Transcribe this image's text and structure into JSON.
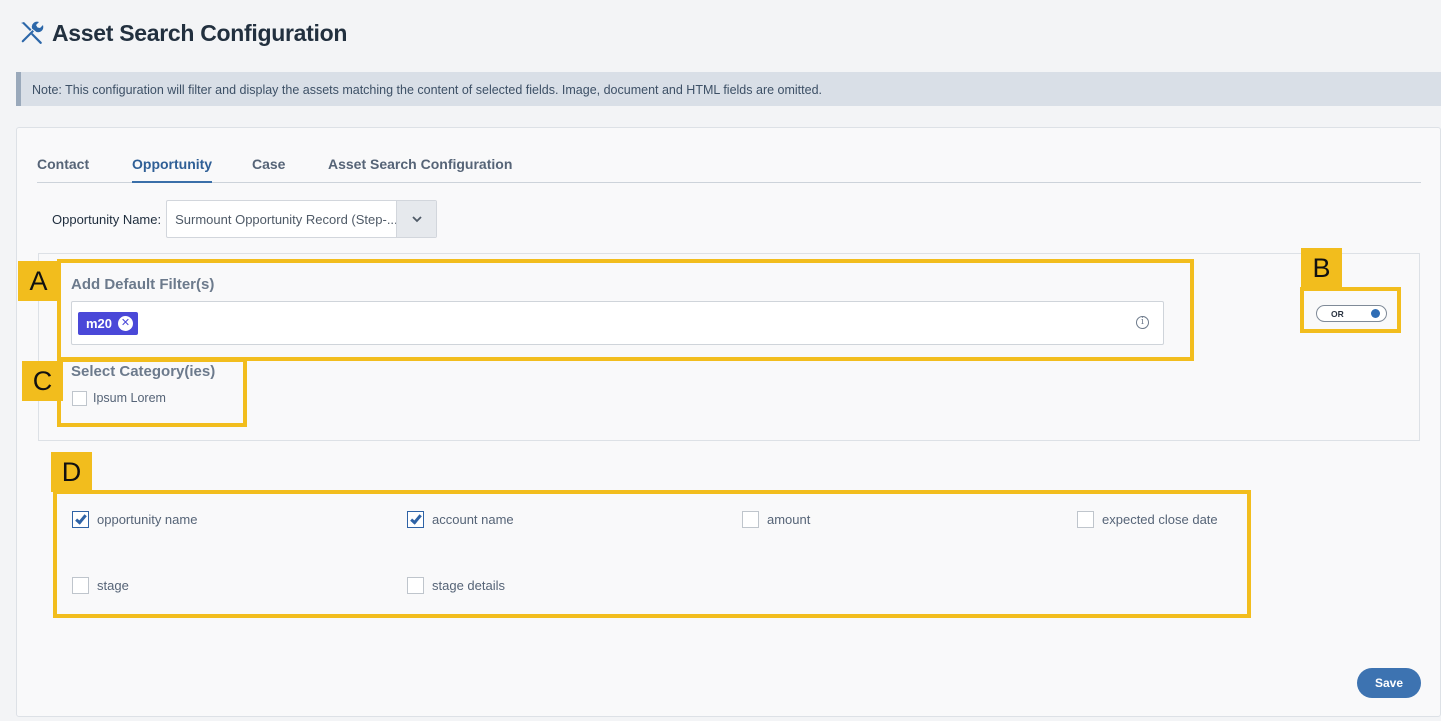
{
  "header": {
    "title": "Asset Search Configuration",
    "icon": "wrench-screwdriver-icon"
  },
  "note": "Note: This configuration will filter and display the assets matching the content of selected fields. Image, document and HTML fields are omitted.",
  "tabs": [
    {
      "label": "Contact",
      "active": false
    },
    {
      "label": "Opportunity",
      "active": true
    },
    {
      "label": "Case",
      "active": false
    },
    {
      "label": "Asset Search Configuration",
      "active": false
    }
  ],
  "opportunity": {
    "label": "Opportunity Name:",
    "selected": "Surmount Opportunity Record (Step-..."
  },
  "default_filter": {
    "title": "Add Default Filter(s)",
    "tags": [
      "m20"
    ]
  },
  "toggle": {
    "label": "OR"
  },
  "category": {
    "title": "Select Category(ies)",
    "options": [
      {
        "label": "Ipsum Lorem",
        "checked": false
      }
    ]
  },
  "fields": [
    {
      "label": "opportunity name",
      "checked": true
    },
    {
      "label": "account name",
      "checked": true
    },
    {
      "label": "amount",
      "checked": false
    },
    {
      "label": "expected close date",
      "checked": false
    },
    {
      "label": "stage",
      "checked": false
    },
    {
      "label": "stage details",
      "checked": false
    }
  ],
  "annotations": {
    "a": "A",
    "b": "B",
    "c": "C",
    "d": "D"
  },
  "save_label": "Save",
  "colors": {
    "highlight": "#f2bd1d",
    "accent": "#3d73b1",
    "chip": "#4a48d8"
  }
}
